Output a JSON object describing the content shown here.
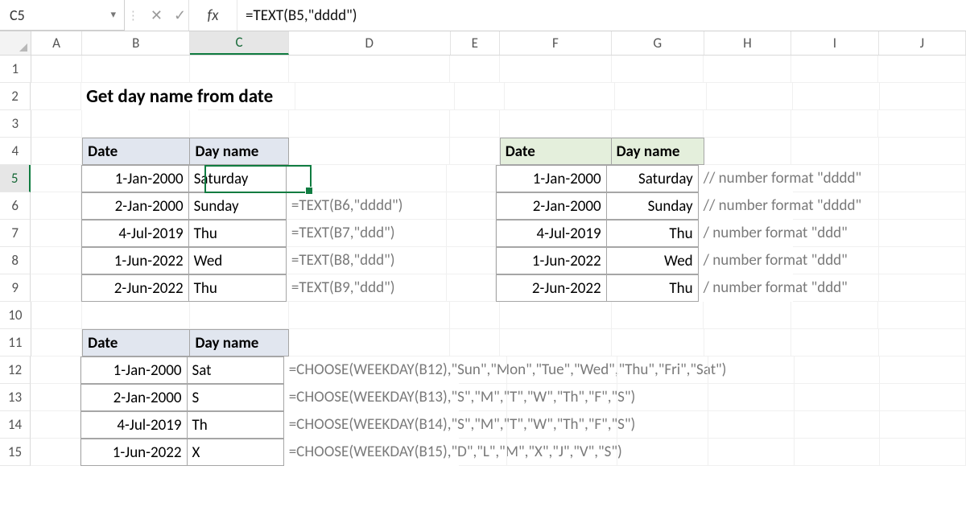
{
  "namebox": {
    "ref": "C5"
  },
  "formula_bar": {
    "fx_label": "fx",
    "value": "=TEXT(B5,\"dddd\")"
  },
  "columns": [
    "A",
    "B",
    "C",
    "D",
    "E",
    "F",
    "G",
    "H",
    "I",
    "J"
  ],
  "active_col": "C",
  "active_row": 5,
  "row_numbers": [
    1,
    2,
    3,
    4,
    5,
    6,
    7,
    8,
    9,
    10,
    11,
    12,
    13,
    14,
    15
  ],
  "title": "Get day name from date",
  "header1": {
    "date": "Date",
    "day": "Day name"
  },
  "header2": {
    "date": "Date",
    "day": "Day name"
  },
  "header3": {
    "date": "Date",
    "day": "Day name"
  },
  "t1": [
    {
      "date": "1-Jan-2000",
      "day": "Saturday",
      "fml": ""
    },
    {
      "date": "2-Jan-2000",
      "day": "Sunday",
      "fml": "=TEXT(B6,\"dddd\")"
    },
    {
      "date": "4-Jul-2019",
      "day": "Thu",
      "fml": "=TEXT(B7,\"ddd\")"
    },
    {
      "date": "1-Jun-2022",
      "day": "Wed",
      "fml": "=TEXT(B8,\"ddd\")"
    },
    {
      "date": "2-Jun-2022",
      "day": "Thu",
      "fml": "=TEXT(B9,\"ddd\")"
    }
  ],
  "t2": [
    {
      "date": "1-Jan-2000",
      "day": "Saturday",
      "note": "// number format \"dddd\""
    },
    {
      "date": "2-Jan-2000",
      "day": "Sunday",
      "note": "// number format \"dddd\""
    },
    {
      "date": "4-Jul-2019",
      "day": "Thu",
      "note": "/ number format \"ddd\""
    },
    {
      "date": "1-Jun-2022",
      "day": "Wed",
      "note": "/ number format \"ddd\""
    },
    {
      "date": "2-Jun-2022",
      "day": "Thu",
      "note": "/ number format \"ddd\""
    }
  ],
  "t3": [
    {
      "date": "1-Jan-2000",
      "day": "Sat",
      "fml": "=CHOOSE(WEEKDAY(B12),\"Sun\",\"Mon\",\"Tue\",\"Wed\",\"Thu\",\"Fri\",\"Sat\")"
    },
    {
      "date": "2-Jan-2000",
      "day": "S",
      "fml": "=CHOOSE(WEEKDAY(B13),\"S\",\"M\",\"T\",\"W\",\"Th\",\"F\",\"S\")"
    },
    {
      "date": "4-Jul-2019",
      "day": "Th",
      "fml": "=CHOOSE(WEEKDAY(B14),\"S\",\"M\",\"T\",\"W\",\"Th\",\"F\",\"S\")"
    },
    {
      "date": "1-Jun-2022",
      "day": "X",
      "fml": "=CHOOSE(WEEKDAY(B15),\"D\",\"L\",\"M\",\"X\",\"J\",\"V\",\"S\")"
    }
  ]
}
